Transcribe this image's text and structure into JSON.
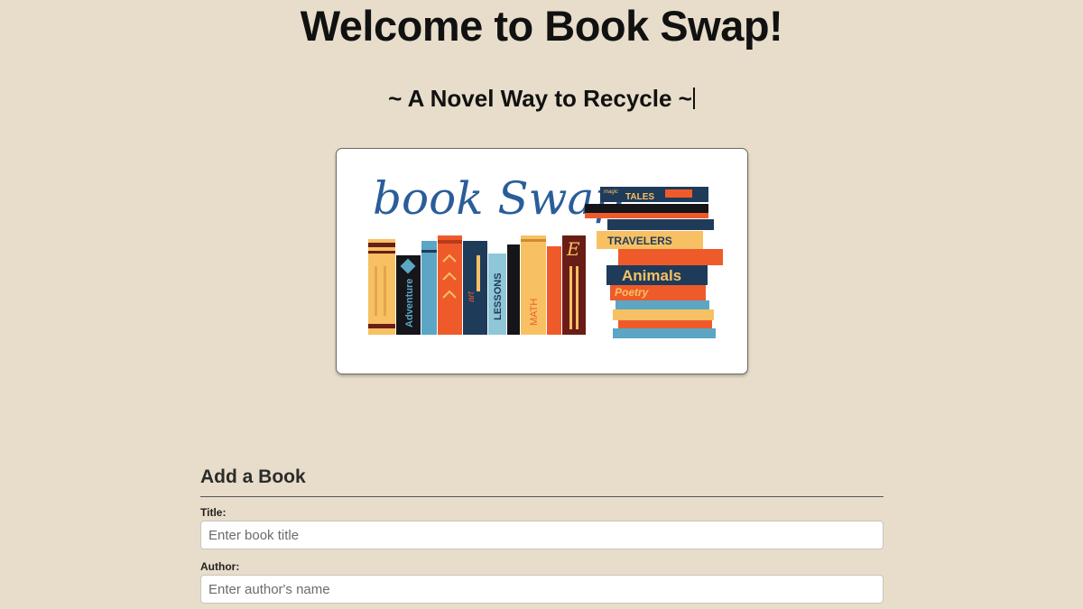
{
  "header": {
    "title": "Welcome to Book Swap!",
    "subtitle": "~ A Novel Way to Recycle ~"
  },
  "logo": {
    "wordmark": "book Swap",
    "spine_labels": [
      "Adventure",
      "art",
      "LESSONS",
      "MATH",
      "E"
    ],
    "stack_labels": [
      "magic",
      "TALES",
      "TRAVELERS",
      "Animals",
      "Poetry"
    ]
  },
  "form": {
    "heading": "Add a Book",
    "title_label": "Title:",
    "title_placeholder": "Enter book title",
    "title_value": "",
    "author_label": "Author:",
    "author_placeholder": "Enter author's name",
    "author_value": ""
  },
  "colors": {
    "background": "#e7ddca",
    "navy": "#1f3b5a",
    "orange": "#ef5a2b",
    "yellow": "#f7c163",
    "teal": "#5aa6c4",
    "maroon": "#6a1d16"
  }
}
